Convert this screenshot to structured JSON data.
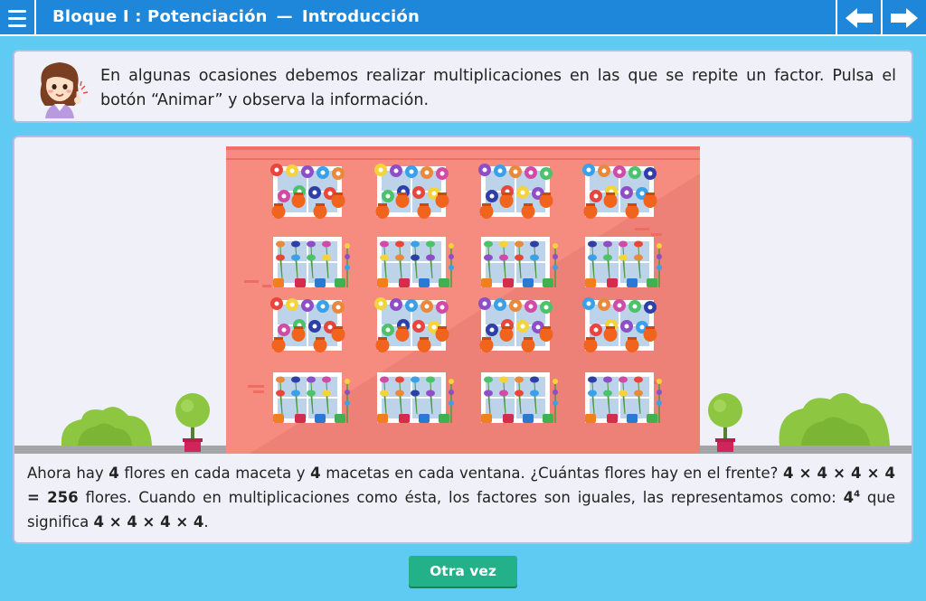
{
  "header": {
    "block": "Bloque I : Potenciación",
    "separator": "—",
    "section": "Introducción"
  },
  "info": {
    "text": "En algunas ocasiones debemos realizar multiplicaciones en las que se repite un factor. Pulsa el botón “Animar” y observa la información."
  },
  "description": {
    "p1": "Ahora hay ",
    "n1": "4",
    "p2": " flores en cada maceta y ",
    "n2": "4",
    "p3": " macetas en cada ventana. ¿Cuántas flores hay en el frente? ",
    "expr": "4 × 4 × 4 × 4 = 256",
    "p4": " flores. Cuando en multiplicaciones como ésta, los factores son iguales, las representamos como: ",
    "base": "4",
    "exp": "4",
    "p5": " que significa ",
    "expanded": "4 × 4 × 4 × 4",
    "p6": "."
  },
  "buttons": {
    "again": "Otra vez"
  },
  "icons": {
    "menu": "menu-icon",
    "prev": "arrow-left-icon",
    "next": "arrow-right-icon"
  },
  "colors": {
    "topbar": "#1e87d9",
    "background": "#5fcbf3",
    "building": "#f68b80",
    "button": "#23b18a"
  },
  "scene": {
    "rows": 4,
    "columns": 4,
    "windows": [
      "flowers-orange-pots",
      "flowers-orange-pots",
      "flowers-orange-pots",
      "flowers-orange-pots",
      "flowers-mixed-pots",
      "flowers-mixed-pots",
      "flowers-mixed-pots",
      "flowers-mixed-pots",
      "flowers-orange-pots",
      "flowers-orange-pots",
      "flowers-orange-pots",
      "flowers-orange-pots",
      "flowers-mixed-pots",
      "flowers-mixed-pots",
      "flowers-mixed-pots",
      "flowers-mixed-pots"
    ]
  }
}
